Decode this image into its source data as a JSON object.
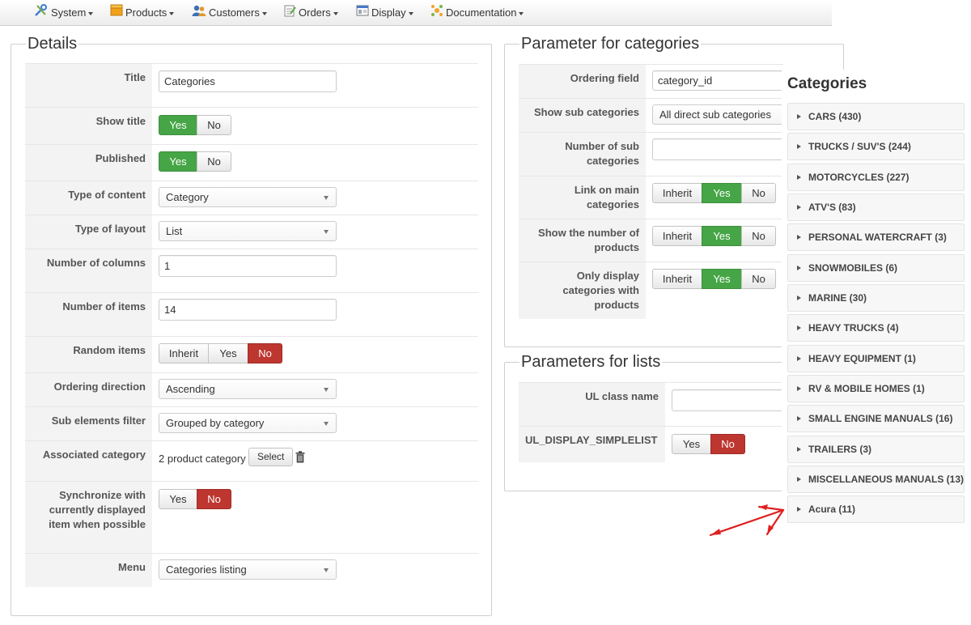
{
  "menu": [
    {
      "label": "System",
      "icon": "tools-icon"
    },
    {
      "label": "Products",
      "icon": "products-box-icon"
    },
    {
      "label": "Customers",
      "icon": "customers-icon"
    },
    {
      "label": "Orders",
      "icon": "orders-icon"
    },
    {
      "label": "Display",
      "icon": "display-icon"
    },
    {
      "label": "Documentation",
      "icon": "documentation-icon"
    }
  ],
  "details": {
    "legend": "Details",
    "title": {
      "label": "Title",
      "value": "Categories"
    },
    "show_title": {
      "label": "Show title",
      "yes": "Yes",
      "no": "No",
      "selected": "Yes"
    },
    "published": {
      "label": "Published",
      "yes": "Yes",
      "no": "No",
      "selected": "Yes"
    },
    "type_of_content": {
      "label": "Type of content",
      "value": "Category"
    },
    "type_of_layout": {
      "label": "Type of layout",
      "value": "List"
    },
    "number_of_columns": {
      "label": "Number of columns",
      "value": "1"
    },
    "number_of_items": {
      "label": "Number of items",
      "value": "14"
    },
    "random_items": {
      "label": "Random items",
      "inherit": "Inherit",
      "yes": "Yes",
      "no": "No",
      "selected": "No"
    },
    "ordering_direction": {
      "label": "Ordering direction",
      "value": "Ascending"
    },
    "sub_elements_filter": {
      "label": "Sub elements filter",
      "value": "Grouped by category"
    },
    "associated_category": {
      "label": "Associated category",
      "value": "2 product category",
      "button": "Select"
    },
    "synchronize": {
      "label": "Synchronize with currently displayed item when possible",
      "yes": "Yes",
      "no": "No",
      "selected": "No"
    },
    "menu": {
      "label": "Menu",
      "value": "Categories listing"
    }
  },
  "param_categories": {
    "legend": "Parameter for categories",
    "ordering_field": {
      "label": "Ordering field",
      "value": "category_id"
    },
    "show_sub_categories": {
      "label": "Show sub categories",
      "value": "All direct sub categories"
    },
    "number_of_sub_categories": {
      "label": "Number of sub categories",
      "value": ""
    },
    "link_on_main_categories": {
      "label": "Link on main categories",
      "inherit": "Inherit",
      "yes": "Yes",
      "no": "No",
      "selected": "Yes"
    },
    "show_number_of_products": {
      "label": "Show the number of products",
      "inherit": "Inherit",
      "yes": "Yes",
      "no": "No",
      "selected": "Yes"
    },
    "only_display_with_products": {
      "label": "Only display categories with products",
      "inherit": "Inherit",
      "yes": "Yes",
      "no": "No",
      "selected": "Yes"
    }
  },
  "param_lists": {
    "legend": "Parameters for lists",
    "ul_class_name": {
      "label": "UL class name",
      "value": ""
    },
    "ul_display_simplelist": {
      "label": "UL_DISPLAY_SIMPLELIST",
      "yes": "Yes",
      "no": "No",
      "selected": "No"
    }
  },
  "categories_module": {
    "title": "Categories",
    "items": [
      "CARS (430)",
      "TRUCKS / SUV'S (244)",
      "MOTORCYCLES (227)",
      "ATV'S (83)",
      "PERSONAL WATERCRAFT (3)",
      "SNOWMOBILES (6)",
      "MARINE (30)",
      "HEAVY TRUCKS (4)",
      "HEAVY EQUIPMENT (1)",
      "RV & MOBILE HOMES (1)",
      "SMALL ENGINE MANUALS (16)",
      "TRAILERS (3)",
      "MISCELLANEOUS MANUALS (13)",
      "Acura (11)"
    ]
  },
  "colors": {
    "yes_active": "#46a546",
    "no_active": "#bd362f",
    "annotation_arrow": "#e02020"
  }
}
